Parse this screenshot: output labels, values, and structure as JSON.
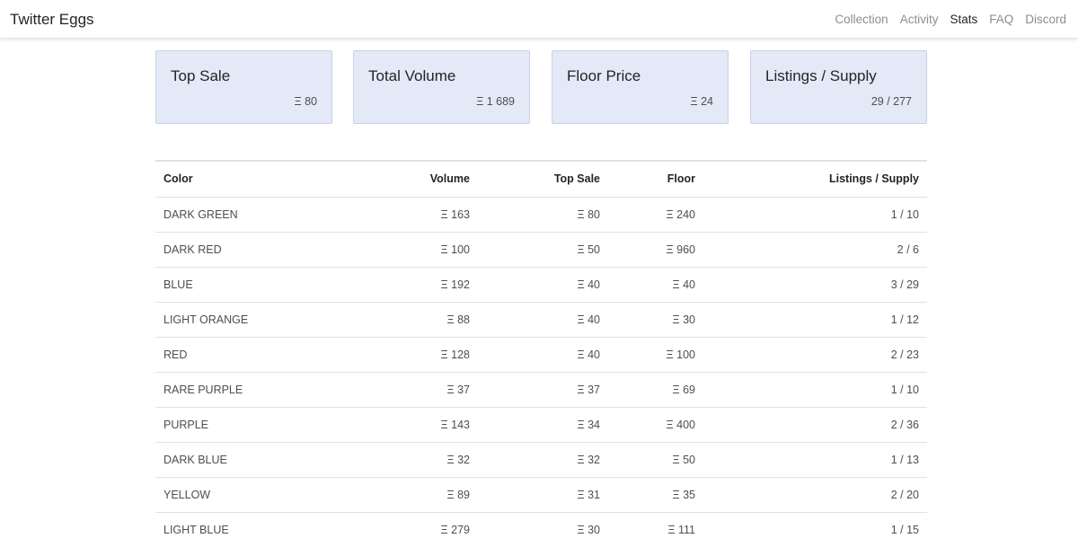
{
  "navbar": {
    "brand": "Twitter Eggs",
    "links": [
      {
        "label": "Collection",
        "active": false
      },
      {
        "label": "Activity",
        "active": false
      },
      {
        "label": "Stats",
        "active": true
      },
      {
        "label": "FAQ",
        "active": false
      },
      {
        "label": "Discord",
        "active": false
      }
    ]
  },
  "cards": [
    {
      "title": "Top Sale",
      "value": "Ξ 80"
    },
    {
      "title": "Total Volume",
      "value": "Ξ 1 689"
    },
    {
      "title": "Floor Price",
      "value": "Ξ 24"
    },
    {
      "title": "Listings / Supply",
      "value": "29 / 277"
    }
  ],
  "table": {
    "headers": [
      "Color",
      "Volume",
      "Top Sale",
      "Floor",
      "Listings / Supply"
    ],
    "rows": [
      [
        "DARK GREEN",
        "Ξ 163",
        "Ξ 80",
        "Ξ 240",
        "1 / 10"
      ],
      [
        "DARK RED",
        "Ξ 100",
        "Ξ 50",
        "Ξ 960",
        "2 / 6"
      ],
      [
        "BLUE",
        "Ξ 192",
        "Ξ 40",
        "Ξ 40",
        "3 / 29"
      ],
      [
        "LIGHT ORANGE",
        "Ξ 88",
        "Ξ 40",
        "Ξ 30",
        "1 / 12"
      ],
      [
        "RED",
        "Ξ 128",
        "Ξ 40",
        "Ξ 100",
        "2 / 23"
      ],
      [
        "RARE PURPLE",
        "Ξ 37",
        "Ξ 37",
        "Ξ 69",
        "1 / 10"
      ],
      [
        "PURPLE",
        "Ξ 143",
        "Ξ 34",
        "Ξ 400",
        "2 / 36"
      ],
      [
        "DARK BLUE",
        "Ξ 32",
        "Ξ 32",
        "Ξ 50",
        "1 / 13"
      ],
      [
        "YELLOW",
        "Ξ 89",
        "Ξ 31",
        "Ξ 35",
        "2 / 20"
      ],
      [
        "LIGHT BLUE",
        "Ξ 279",
        "Ξ 30",
        "Ξ 111",
        "1 / 15"
      ]
    ]
  },
  "colors": {
    "card_background": "#e3e9f6",
    "card_border": "#c8d2e6",
    "nav_inactive": "#8a8f94",
    "nav_active": "#212529"
  }
}
